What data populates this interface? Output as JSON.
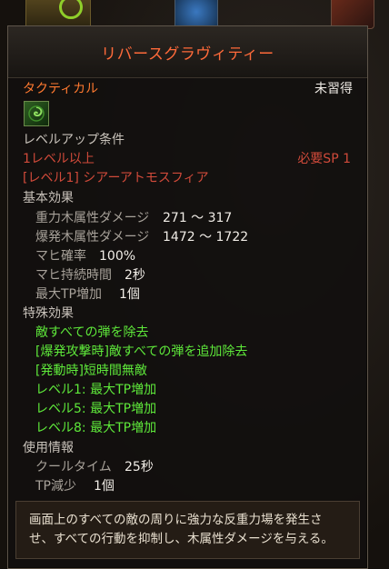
{
  "tooltip": {
    "title": "リバースグラヴィティー",
    "type_label": "タクティカル",
    "status": "未習得",
    "skill_icon": "green-swirl-icon",
    "levelup_header": "レベルアップ条件",
    "req_level": "1レベル以上",
    "req_sp": "必要SP 1",
    "req_skill": "[レベル1] シアーアトモスフィア",
    "basic_header": "基本効果",
    "basic_effects": [
      {
        "label": "重力木属性ダメージ",
        "value": "271 ～ 317"
      },
      {
        "label": "爆発木属性ダメージ",
        "value": "1472 ～ 1722"
      },
      {
        "label": "マヒ確率",
        "value": "100%"
      },
      {
        "label": "マヒ持続時間",
        "value": "2秒"
      },
      {
        "label": "最大TP増加",
        "value": "1個"
      }
    ],
    "special_header": "特殊効果",
    "special_effects": [
      "敵すべての弾を除去",
      "[爆発攻撃時]敵すべての弾を追加除去",
      "[発動時]短時間無敵",
      "レベル1: 最大TP増加",
      "レベル5: 最大TP増加",
      "レベル8: 最大TP増加"
    ],
    "usage_header": "使用情報",
    "usage": [
      {
        "label": "クールタイム",
        "value": "25秒"
      },
      {
        "label": "TP減少",
        "value": "1個"
      }
    ],
    "description_line1": "画面上のすべての敵の周りに強力な反重力場を発生さ",
    "description_line2": "せ、すべての行動を抑制し、木属性ダメージを与える。"
  },
  "colors": {
    "title": "#ff6a3a",
    "type": "#ff7a30",
    "requirement": "#d04a3a",
    "special": "#5ee83a"
  }
}
